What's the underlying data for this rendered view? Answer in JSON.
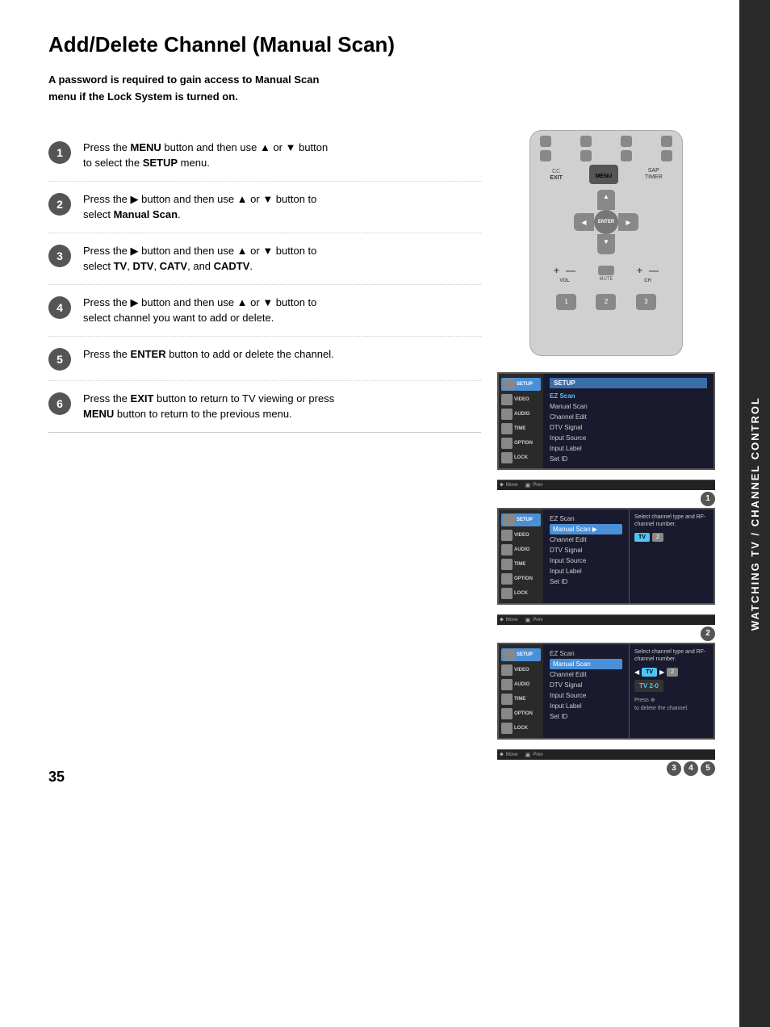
{
  "sidebar": {
    "text": "WATCHING TV / CHANNEL CONTROL"
  },
  "page": {
    "number": "35",
    "title": "Add/Delete Channel (Manual Scan)",
    "subtitle": "A password is required to gain access to Manual Scan\nmenu if the Lock System is turned on."
  },
  "steps": [
    {
      "number": "1",
      "text_parts": [
        {
          "text": "Press the ",
          "bold": false
        },
        {
          "text": "MENU",
          "bold": true
        },
        {
          "text": " button and then use ▲ or ▼ button\nto select the ",
          "bold": false
        },
        {
          "text": "SETUP",
          "bold": true
        },
        {
          "text": " menu.",
          "bold": false
        }
      ]
    },
    {
      "number": "2",
      "text_parts": [
        {
          "text": "Press the ▶ button and then use ▲ or ▼ button to\nselect ",
          "bold": false
        },
        {
          "text": "Manual Scan",
          "bold": true
        },
        {
          "text": ".",
          "bold": false
        }
      ]
    },
    {
      "number": "3",
      "text_parts": [
        {
          "text": "Press the ▶ button and then use ▲ or ▼ button to\nselect ",
          "bold": false
        },
        {
          "text": "TV",
          "bold": true
        },
        {
          "text": ", ",
          "bold": false
        },
        {
          "text": "DTV",
          "bold": true
        },
        {
          "text": ", ",
          "bold": false
        },
        {
          "text": "CATV",
          "bold": true
        },
        {
          "text": ", and ",
          "bold": false
        },
        {
          "text": "CADTV",
          "bold": true
        },
        {
          "text": ".",
          "bold": false
        }
      ]
    },
    {
      "number": "4",
      "text_parts": [
        {
          "text": "Press the ▶ button and then use ▲ or ▼ button to\nselect channel you want to add or delete.",
          "bold": false
        }
      ]
    },
    {
      "number": "5",
      "text_parts": [
        {
          "text": "Press the ",
          "bold": false
        },
        {
          "text": "ENTER",
          "bold": true
        },
        {
          "text": " button to add or delete the channel.",
          "bold": false
        }
      ]
    },
    {
      "number": "6",
      "text_parts": [
        {
          "text": "Press the ",
          "bold": false
        },
        {
          "text": "EXIT",
          "bold": true
        },
        {
          "text": " button to return to TV viewing or press\n",
          "bold": false
        },
        {
          "text": "MENU",
          "bold": true
        },
        {
          "text": " button to return to the previous menu.",
          "bold": false
        }
      ]
    }
  ],
  "screen1": {
    "sidebar_items": [
      "SETUP",
      "VIDEO",
      "AUDIO",
      "TIME",
      "OPTION",
      "LOCK"
    ],
    "menu_items": [
      "EZ Scan",
      "Manual Scan",
      "Channel Edit",
      "DTV Signal",
      "Input Source",
      "Input Label",
      "Set ID"
    ],
    "footer": "Move  Press",
    "badge": "1"
  },
  "screen2": {
    "sidebar_items": [
      "SETUP",
      "VIDEO",
      "AUDIO",
      "TIME",
      "OPTION",
      "LOCK"
    ],
    "menu_items": [
      "EZ Scan",
      "Manual Scan",
      "Channel Edit",
      "DTV Signal",
      "Input Source",
      "Input Label",
      "Set ID"
    ],
    "right_text": "Select channel type and RF-channel number.",
    "channel_type": "TV",
    "channel_num": "2",
    "footer": "Move  Press",
    "badge": "2"
  },
  "screen3": {
    "sidebar_items": [
      "SETUP",
      "VIDEO",
      "AUDIO",
      "TIME",
      "OPTION",
      "LOCK"
    ],
    "menu_items": [
      "EZ Scan",
      "Manual Scan",
      "Channel Edit",
      "DTV Signal",
      "Input Source",
      "Input Label",
      "Set ID"
    ],
    "right_text": "Select channel type and RF-channel number.",
    "channel_type": "TV",
    "channel_num": "2",
    "tv_value": "TV 2-0",
    "press_note": "Press ⊕\nto delete the channel.",
    "footer": "Move  Press",
    "badge": "3 4 5"
  },
  "remote": {
    "enter_label": "ENTER",
    "exit_label": "EXIT",
    "menu_label": "MENU",
    "sap_label": "SAP",
    "cc_label": "CC",
    "timer_label": "TIMER",
    "vol_label": "VOL",
    "ch_label": "CH"
  }
}
